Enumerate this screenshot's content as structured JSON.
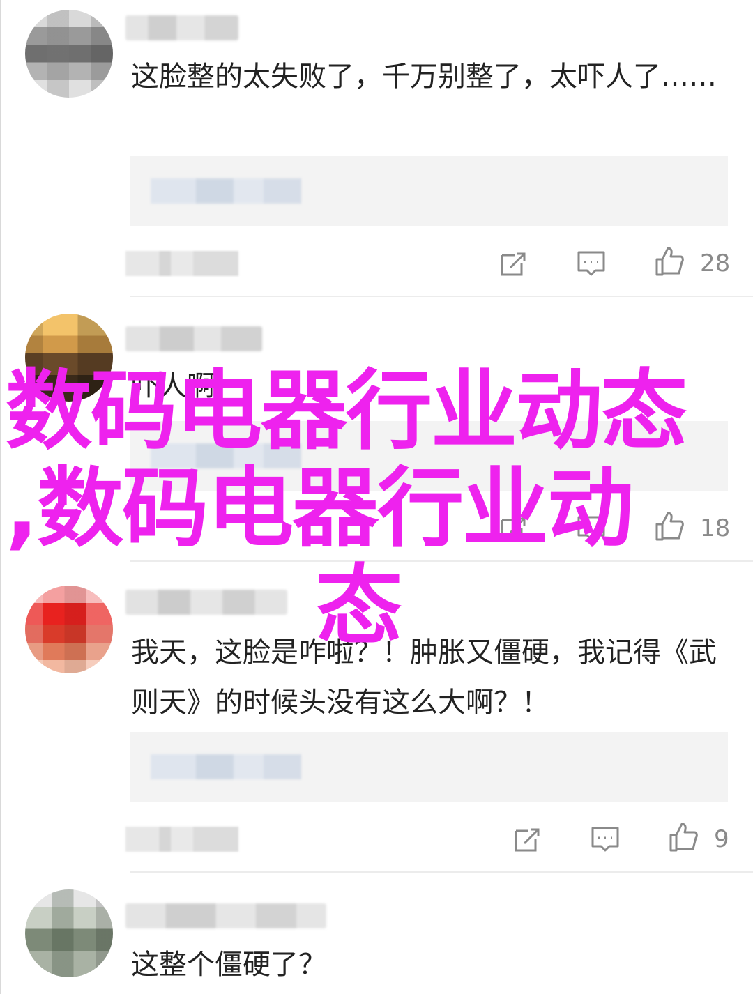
{
  "comments": [
    {
      "text": "这脸整的太失败了，千万别整了，太吓人了……",
      "like_count": "28"
    },
    {
      "text": "吓人啊",
      "like_count": "18"
    },
    {
      "text": "我天，这脸是咋啦？！肿胀又僵硬，我记得《武则天》的时候头没有这么大啊？！",
      "like_count": "9"
    },
    {
      "text": "这整个僵硬了？"
    }
  ],
  "overlay": {
    "title_line1": "数码电器行业动态",
    "title_line2": ",数码电器行业动",
    "title_line3": "态",
    "color": "#ee22ee"
  },
  "icons": {
    "share": "share-icon",
    "reply": "reply-icon",
    "like": "thumbs-up-icon"
  }
}
